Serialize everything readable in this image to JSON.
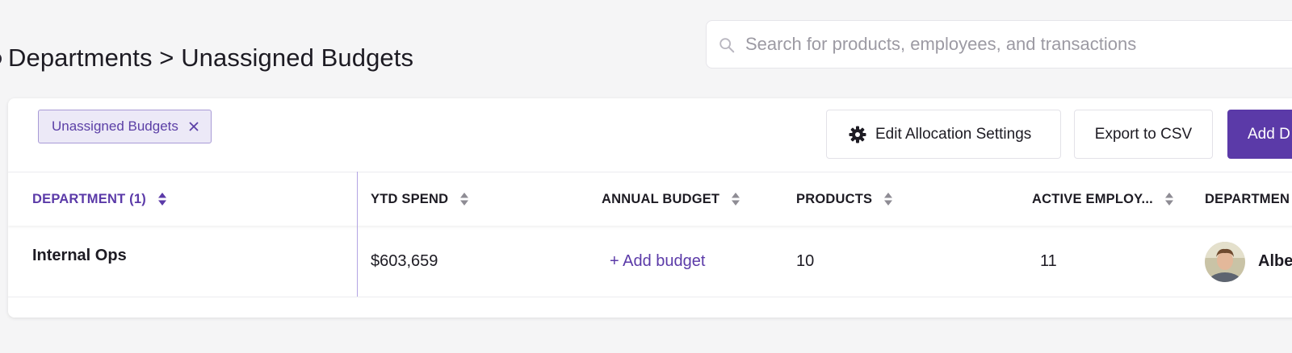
{
  "header": {
    "breadcrumb": "Departments > Unassigned Budgets"
  },
  "search": {
    "placeholder": "Search for products, employees, and transactions",
    "value": ""
  },
  "filter_chip": {
    "label": "Unassigned Budgets"
  },
  "toolbar": {
    "edit_allocation_label": "Edit Allocation Settings",
    "export_label": "Export to CSV",
    "add_label": "Add D"
  },
  "table": {
    "columns": [
      "DEPARTMENT (1)",
      "YTD SPEND",
      "ANNUAL BUDGET",
      "PRODUCTS",
      "ACTIVE EMPLOY...",
      "DEPARTMEN"
    ],
    "rows": [
      {
        "department": "Internal Ops",
        "ytd_spend": "$603,659",
        "annual_budget_action": "+ Add budget",
        "products": "10",
        "active_employees": "11",
        "owner_name": "Albe"
      }
    ]
  },
  "colors": {
    "accent": "#5b3aa8",
    "chip_bg": "#ece9f7",
    "background": "#f5f5f6"
  },
  "icons": {
    "search": "search-icon",
    "close": "close-icon",
    "gear": "gear-icon",
    "sort": "sort-icon"
  }
}
